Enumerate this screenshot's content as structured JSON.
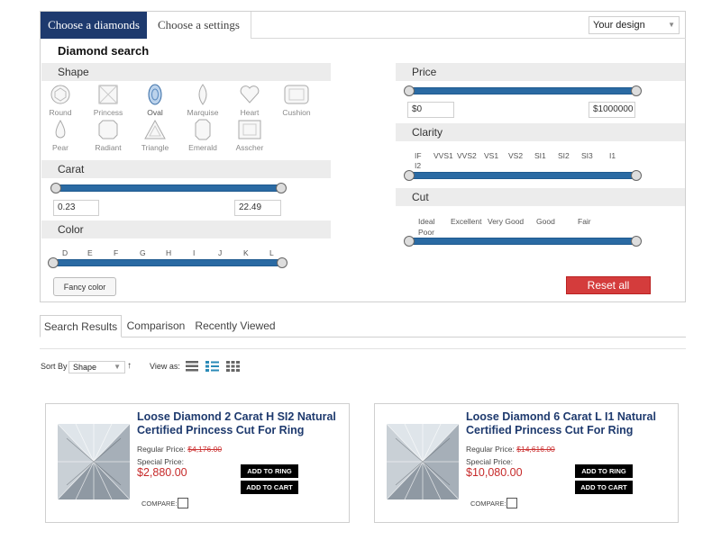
{
  "top_tabs": {
    "choose_diamonds": "Choose a diamonds",
    "choose_settings": "Choose a settings"
  },
  "design_select": {
    "value": "Your design"
  },
  "search_title": "Diamond search",
  "shape": {
    "label": "Shape",
    "items": [
      "Round",
      "Princess",
      "Oval",
      "Marquise",
      "Heart",
      "Cushion",
      "Pear",
      "Radiant",
      "Triangle",
      "Emerald",
      "Asscher"
    ],
    "selected": "Oval"
  },
  "carat": {
    "label": "Carat",
    "min": "0.23",
    "max": "22.49"
  },
  "color": {
    "label": "Color",
    "grades": [
      "D",
      "E",
      "F",
      "G",
      "H",
      "I",
      "J",
      "K",
      "L"
    ],
    "fancy_button": "Fancy color"
  },
  "price": {
    "label": "Price",
    "min": "$0",
    "max": "$1000000"
  },
  "clarity": {
    "label": "Clarity",
    "grades": [
      "IF",
      "VVS1",
      "VVS2",
      "VS1",
      "VS2",
      "SI1",
      "SI2",
      "SI3",
      "I1",
      "I2"
    ]
  },
  "cut": {
    "label": "Cut",
    "grades": [
      "Ideal",
      "Excellent",
      "Very Good",
      "Good",
      "Fair",
      "Poor"
    ]
  },
  "reset_button": "Reset all",
  "result_tabs": [
    "Search Results",
    "Comparison",
    "Recently Viewed"
  ],
  "sort": {
    "label": "Sort By",
    "value": "Shape",
    "direction_icon": "↑"
  },
  "view_as": {
    "label": "View as:"
  },
  "products": [
    {
      "title": "Loose Diamond 2 Carat H SI2 Natural Certified Princess Cut For Ring",
      "regular_label": "Regular Price:",
      "regular_price": "$4,176.00",
      "special_label": "Special Price:",
      "special_price": "$2,880.00",
      "add_ring": "ADD TO RING",
      "add_cart": "ADD TO CART",
      "compare": "COMPARE:"
    },
    {
      "title": "Loose Diamond 6 Carat L I1 Natural Certified Princess Cut For Ring",
      "regular_label": "Regular Price:",
      "regular_price": "$14,616.00",
      "special_label": "Special Price:",
      "special_price": "$10,080.00",
      "add_ring": "ADD TO RING",
      "add_cart": "ADD TO CART",
      "compare": "COMPARE:"
    }
  ],
  "colors": {
    "accent": "#1e3a6e",
    "slider": "#2a6aa3",
    "reset": "#d43c3c",
    "price_red": "#c62a2a"
  }
}
